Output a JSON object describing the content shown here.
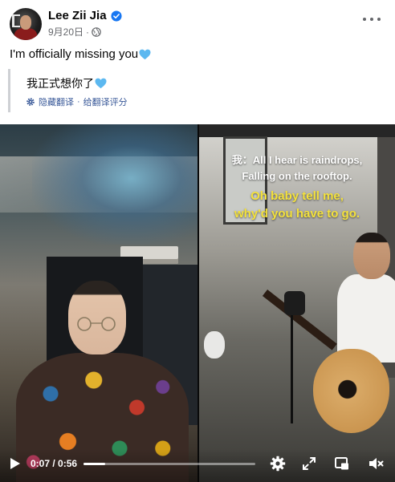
{
  "post": {
    "author": "Lee Zii Jia",
    "date": "9月20日",
    "text": "I'm officially missing you",
    "translation": {
      "text": "我正式想你了",
      "hide_label": "隐藏翻译",
      "separator": "·",
      "rate_label": "给翻译评分"
    }
  },
  "video": {
    "lyrics": {
      "line1": "我：All I hear is raindrops,",
      "line2": "Falling on the rooftop.",
      "line3": "Oh baby tell me,",
      "line4": "why'd you have to go."
    },
    "current_time": "0:07",
    "duration": "0:56",
    "time_display": "0:07 / 0:56",
    "progress_fraction": 0.125
  },
  "colors": {
    "link": "#385898",
    "meta": "#65676b",
    "verified": "#1877f2",
    "heart": "#5cb8f0",
    "lyric_yellow": "#f4e23c"
  },
  "icons": {
    "verified": "verified-badge-icon",
    "privacy": "globe-icon",
    "more": "more-dots-icon",
    "heart": "blue-heart-icon",
    "translate_settings": "gear-icon",
    "play": "play-icon",
    "settings": "settings-gear-icon",
    "expand": "expand-icon",
    "pip": "picture-in-picture-icon",
    "volume": "volume-muted-icon"
  }
}
